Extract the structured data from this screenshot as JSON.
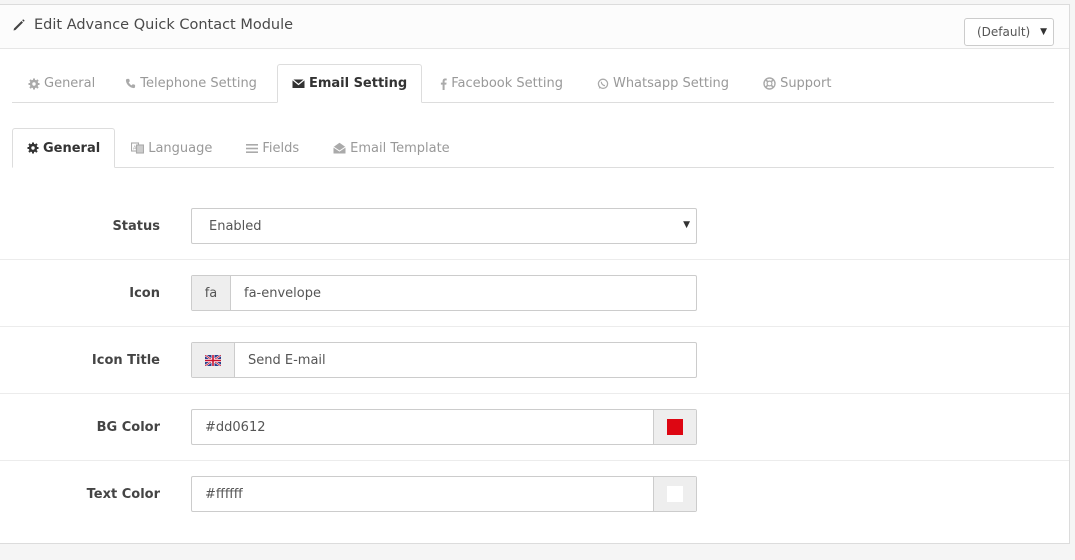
{
  "header": {
    "title": "Edit Advance Quick Contact Module",
    "store_select": "(Default)"
  },
  "main_tabs": [
    {
      "label": "General",
      "icon": "gear-icon",
      "active": false
    },
    {
      "label": "Telephone Setting",
      "icon": "phone-icon",
      "active": false
    },
    {
      "label": "Email Setting",
      "icon": "envelope-icon",
      "active": true
    },
    {
      "label": "Facebook Setting",
      "icon": "facebook-icon",
      "active": false
    },
    {
      "label": "Whatsapp Setting",
      "icon": "whatsapp-icon",
      "active": false
    },
    {
      "label": "Support",
      "icon": "lifebuoy-icon",
      "active": false
    }
  ],
  "sub_tabs": [
    {
      "label": "General",
      "icon": "gear-icon",
      "active": true
    },
    {
      "label": "Language",
      "icon": "language-icon",
      "active": false
    },
    {
      "label": "Fields",
      "icon": "list-icon",
      "active": false
    },
    {
      "label": "Email Template",
      "icon": "envelope-open-icon",
      "active": false
    }
  ],
  "form": {
    "status": {
      "label": "Status",
      "value": "Enabled"
    },
    "icon": {
      "label": "Icon",
      "addon": "fa",
      "value": "fa-envelope"
    },
    "icon_title": {
      "label": "Icon Title",
      "value": "Send E-mail"
    },
    "bg_color": {
      "label": "BG Color",
      "value": "#dd0612",
      "swatch": "#dd0612"
    },
    "text_color": {
      "label": "Text Color",
      "value": "#ffffff",
      "swatch": "#ffffff"
    }
  }
}
